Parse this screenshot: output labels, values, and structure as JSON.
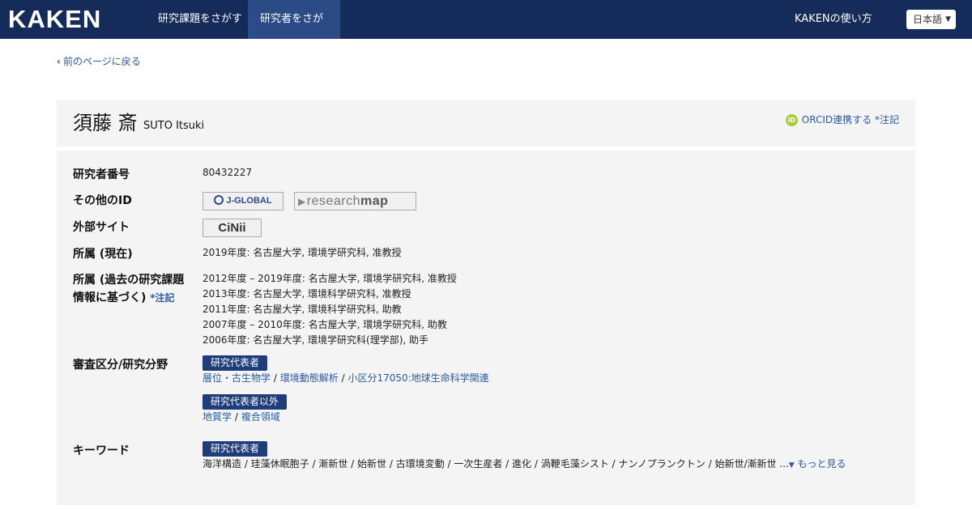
{
  "header": {
    "logo": "KAKEN",
    "nav": [
      "研究課題をさがす",
      "研究者をさがす"
    ],
    "help": "KAKENの使い方",
    "language": "日本語"
  },
  "back_link": "前のページに戻る",
  "profile": {
    "name_jp": "須藤 斎",
    "name_en": "SUTO Itsuki",
    "orcid_label": "ORCID連携する",
    "orcid_note": "*注記"
  },
  "info": {
    "researcher_id_label": "研究者番号",
    "researcher_id": "80432227",
    "other_id_label": "その他のID",
    "jglobal": "J-GLOBAL",
    "researchmap_a": "research",
    "researchmap_b": "map",
    "external_label": "外部サイト",
    "cinii": "CiNii",
    "current_affil_label": "所属 (現在)",
    "current_affil": "2019年度: 名古屋大学, 環境学研究科, 准教授",
    "past_affil_label_1": "所属 (過去の研究課題",
    "past_affil_label_2": "情報に基づく)",
    "past_affil_note": "*注記",
    "past_affil": [
      "2012年度 – 2019年度: 名古屋大学, 環境学研究科, 准教授",
      "2013年度: 名古屋大学, 環境科学研究科, 准教授",
      "2011年度: 名古屋大学, 環境科学研究科, 助教",
      "2007年度 – 2010年度: 名古屋大学, 環境学研究科, 助教",
      "2006年度: 名古屋大学, 環境学研究科(理学部), 助手"
    ],
    "field_label": "審査区分/研究分野",
    "field_rep_tag": "研究代表者",
    "field_rep": [
      "層位・古生物学",
      "環境動態解析",
      "小区分17050:地球生命科学関連"
    ],
    "field_other_tag": "研究代表者以外",
    "field_other": [
      "地質学",
      "複合領域"
    ],
    "keyword_label": "キーワード",
    "keyword_tag": "研究代表者",
    "keywords": "海洋構造 / 珪藻休眠胞子 / 漸新世 / 始新世 / 古環境変動 / 一次生産者 / 進化 / 渦鞭毛藻シスト / ナンノプランクトン / 始新世/漸新世 ...",
    "more": "もっと見る"
  }
}
